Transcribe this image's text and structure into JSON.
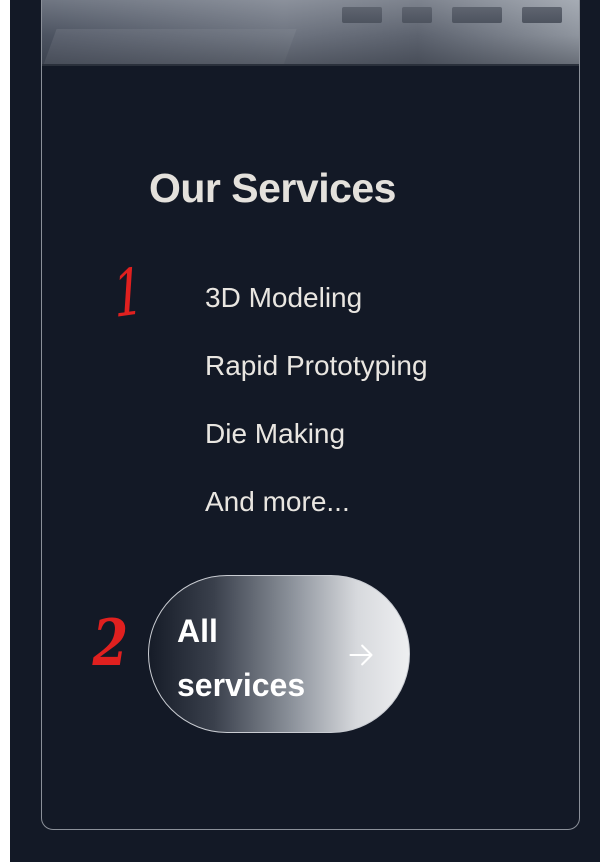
{
  "section": {
    "title": "Our Services",
    "services": [
      "3D Modeling",
      "Rapid Prototyping",
      "Die Making",
      "And more..."
    ],
    "cta": {
      "label": "All services",
      "icon": "arrow-right-icon"
    }
  },
  "annotations": {
    "marker_1": "1",
    "marker_2": "2",
    "color": "#e0201f"
  },
  "colors": {
    "background": "#131926",
    "title": "#e4e1dc",
    "text": "#e9e6e1",
    "border": "#8b9099"
  }
}
